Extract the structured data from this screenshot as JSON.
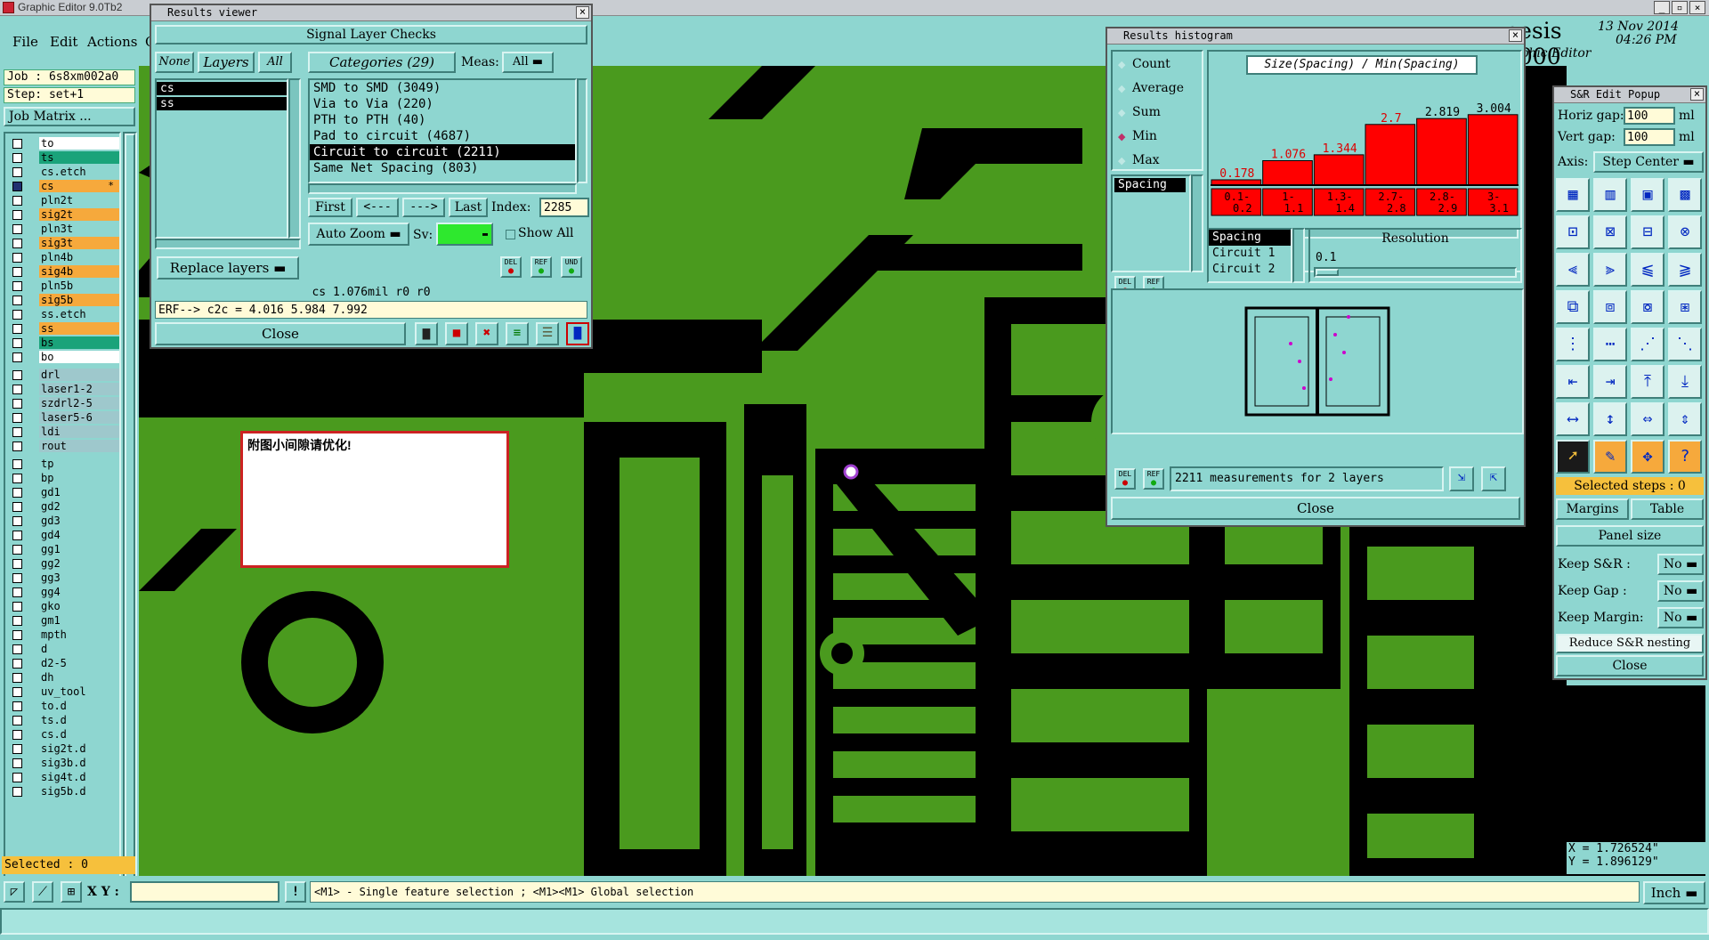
{
  "app": {
    "title": "Graphic Editor 9.0Tb2",
    "menu": [
      "File",
      "Edit",
      "Actions"
    ],
    "menu_trailing": "O",
    "brand": "nesis 2000",
    "brand_sub": "aphic Editor",
    "date": "13 Nov 2014",
    "time": "04:26 PM"
  },
  "left": {
    "job": "Job : 6s8xm002a0",
    "step": "Step: set+1",
    "job_matrix": "Job Matrix ...",
    "selected": "Selected : 0",
    "layers": [
      {
        "name": "to",
        "color": "w",
        "on": false
      },
      {
        "name": "ts",
        "color": "g",
        "on": false
      },
      {
        "name": "cs.etch",
        "color": "t",
        "on": false
      },
      {
        "name": "cs",
        "color": "o",
        "on": true,
        "marker": "*"
      },
      {
        "name": "pln2t",
        "color": "t",
        "on": false
      },
      {
        "name": "sig2t",
        "color": "o",
        "on": false
      },
      {
        "name": "pln3t",
        "color": "t",
        "on": false
      },
      {
        "name": "sig3t",
        "color": "o",
        "on": false
      },
      {
        "name": "pln4b",
        "color": "t",
        "on": false
      },
      {
        "name": "sig4b",
        "color": "o",
        "on": false
      },
      {
        "name": "pln5b",
        "color": "t",
        "on": false
      },
      {
        "name": "sig5b",
        "color": "o",
        "on": false
      },
      {
        "name": "ss.etch",
        "color": "t",
        "on": false
      },
      {
        "name": "ss",
        "color": "o",
        "on": false
      },
      {
        "name": "bs",
        "color": "g",
        "on": false
      },
      {
        "name": "bo",
        "color": "w",
        "on": false
      },
      {
        "name": "drl",
        "color": "s",
        "on": false
      },
      {
        "name": "laser1-2",
        "color": "s",
        "on": false
      },
      {
        "name": "szdrl2-5",
        "color": "s",
        "on": false
      },
      {
        "name": "laser5-6",
        "color": "s",
        "on": false
      },
      {
        "name": "ldi",
        "color": "s",
        "on": false
      },
      {
        "name": "rout",
        "color": "s",
        "on": false
      },
      {
        "name": "tp",
        "color": "t",
        "on": false
      },
      {
        "name": "bp",
        "color": "t",
        "on": false
      },
      {
        "name": "gd1",
        "color": "t",
        "on": false
      },
      {
        "name": "gd2",
        "color": "t",
        "on": false
      },
      {
        "name": "gd3",
        "color": "t",
        "on": false
      },
      {
        "name": "gd4",
        "color": "t",
        "on": false
      },
      {
        "name": "gg1",
        "color": "t",
        "on": false
      },
      {
        "name": "gg2",
        "color": "t",
        "on": false
      },
      {
        "name": "gg3",
        "color": "t",
        "on": false
      },
      {
        "name": "gg4",
        "color": "t",
        "on": false
      },
      {
        "name": "gko",
        "color": "t",
        "on": false
      },
      {
        "name": "gm1",
        "color": "t",
        "on": false
      },
      {
        "name": "mpth",
        "color": "t",
        "on": false
      },
      {
        "name": "d",
        "color": "t",
        "on": false
      },
      {
        "name": "d2-5",
        "color": "t",
        "on": false
      },
      {
        "name": "dh",
        "color": "t",
        "on": false
      },
      {
        "name": "uv_tool",
        "color": "t",
        "on": false
      },
      {
        "name": "to.d",
        "color": "t",
        "on": false
      },
      {
        "name": "ts.d",
        "color": "t",
        "on": false
      },
      {
        "name": "cs.d",
        "color": "t",
        "on": false
      },
      {
        "name": "sig2t.d",
        "color": "t",
        "on": false
      },
      {
        "name": "sig3b.d",
        "color": "t",
        "on": false
      },
      {
        "name": "sig4t.d",
        "color": "t",
        "on": false
      },
      {
        "name": "sig5b.d",
        "color": "t",
        "on": false
      }
    ]
  },
  "note": {
    "text": "附图小间隙请优化!"
  },
  "results_viewer": {
    "title": "Results viewer",
    "header": "Signal Layer Checks",
    "none_btn": "None",
    "layers_btn": "Layers",
    "all_btn": "All",
    "categories_btn": "Categories (29)",
    "meas_label": "Meas:",
    "meas_value": "All",
    "layer_list": [
      "cs",
      "ss"
    ],
    "categories": [
      {
        "label": "SMD to SMD (3049)",
        "selected": false
      },
      {
        "label": "Via to Via (220)",
        "selected": false
      },
      {
        "label": "PTH to PTH (40)",
        "selected": false
      },
      {
        "label": "Pad to circuit (4687)",
        "selected": false
      },
      {
        "label": "Circuit to circuit (2211)",
        "selected": true
      },
      {
        "label": "Same Net Spacing (803)",
        "selected": false
      }
    ],
    "first": "First",
    "prev": "<---",
    "next": "--->",
    "last": "Last",
    "index_label": "Index:",
    "index_value": "2285",
    "auto_zoom": "Auto Zoom",
    "sv_label": "Sv:",
    "show_all": "Show All",
    "replace_layers": "Replace layers",
    "del": "DEL",
    "ref": "REF",
    "und": "UND",
    "status": "cs 1.076mil  r0  r0",
    "erf": "ERF--> c2c = 4.016 5.984 7.992",
    "close": "Close"
  },
  "histogram": {
    "title": "Results histogram",
    "modes": [
      {
        "label": "Count",
        "on": false
      },
      {
        "label": "Average",
        "on": false
      },
      {
        "label": "Sum",
        "on": false
      },
      {
        "label": "Min",
        "on": true
      },
      {
        "label": "Max",
        "on": false
      }
    ],
    "chart_title": "Size(Spacing) / Min(Spacing)",
    "bar_values": [
      "0.178",
      "1.076",
      "1.344",
      "2.7",
      "2.819",
      "3.004"
    ],
    "bar_levels": [
      0.04,
      0.25,
      0.31,
      0.62,
      0.68,
      0.72
    ],
    "bar_ranges": [
      [
        "0.1-",
        "0.2"
      ],
      [
        "1-",
        "1.1"
      ],
      [
        "1.3-",
        "1.4"
      ],
      [
        "2.7-",
        "2.8"
      ],
      [
        "2.8-",
        "2.9"
      ],
      [
        "3-",
        "3.1"
      ]
    ],
    "left_list": [
      "Spacing"
    ],
    "attr_list": [
      {
        "label": "Spacing",
        "selected": true
      },
      {
        "label": "Circuit 1",
        "selected": false
      },
      {
        "label": "Circuit 2",
        "selected": false
      }
    ],
    "resolution_label": "Resolution",
    "resolution_value": "0.1",
    "del": "DEL",
    "ref": "REF",
    "measurements": "2211 measurements for 2 layers",
    "close": "Close"
  },
  "sr_popup": {
    "title": "S&R Edit Popup",
    "horiz_label": "Horiz gap:",
    "horiz_value": "100",
    "vert_label": "Vert  gap:",
    "vert_value": "100",
    "unit": "ml",
    "axis_label": "Axis:",
    "axis_value": "Step Center",
    "selected_steps": "Selected steps : 0",
    "margins": "Margins",
    "table": "Table",
    "panel_size": "Panel size",
    "keep_sr_label": "Keep S&R  :",
    "keep_sr": "No",
    "keep_gap_label": "Keep Gap   :",
    "keep_gap": "No",
    "keep_margin_label": "Keep Margin:",
    "keep_margin": "No",
    "reduce": "Reduce S&R nesting",
    "close": "Close"
  },
  "coords": {
    "x": "X = 1.726524\"",
    "y": "Y = 1.896129\""
  },
  "bottom": {
    "xy_label": "X Y :",
    "xy_value": "",
    "hint": "<M1> - Single feature selection ; <M1><M1> Global selection",
    "unit": "Inch"
  },
  "colors": {
    "panel": "#8ed6d0",
    "pcb_green": "#4a9a1e",
    "pcb_black": "#000000",
    "bar_red": "#ff0000",
    "note_border": "#cc2222"
  }
}
